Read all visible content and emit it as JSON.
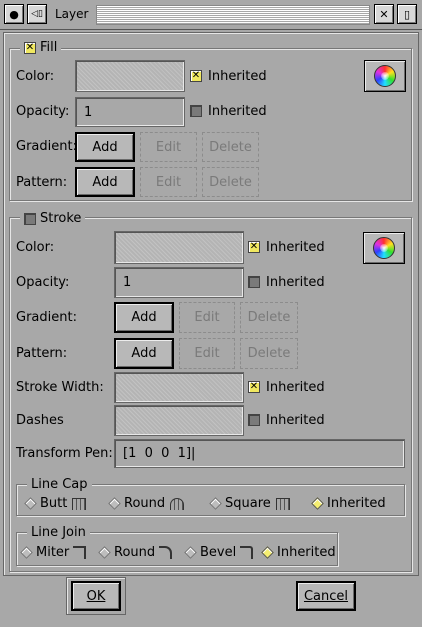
{
  "window": {
    "title": "Layer",
    "menu_glyph": "●",
    "shade_glyph": "◁▯",
    "close_glyph": "✕",
    "max_glyph": "▯"
  },
  "fill": {
    "legend": "Fill",
    "enabled": true,
    "color": {
      "label": "Color:",
      "inherited_label": "Inherited",
      "inherited": true
    },
    "opacity": {
      "label": "Opacity:",
      "value": "1",
      "inherited_label": "Inherited",
      "inherited": false
    },
    "gradient": {
      "label": "Gradient:",
      "add": "Add",
      "edit": "Edit",
      "delete": "Delete"
    },
    "pattern": {
      "label": "Pattern:",
      "add": "Add",
      "edit": "Edit",
      "delete": "Delete"
    }
  },
  "stroke": {
    "legend": "Stroke",
    "enabled": false,
    "color": {
      "label": "Color:",
      "inherited_label": "Inherited",
      "inherited": true
    },
    "opacity": {
      "label": "Opacity:",
      "value": "1",
      "inherited_label": "Inherited",
      "inherited": false
    },
    "gradient": {
      "label": "Gradient:",
      "add": "Add",
      "edit": "Edit",
      "delete": "Delete"
    },
    "pattern": {
      "label": "Pattern:",
      "add": "Add",
      "edit": "Edit",
      "delete": "Delete"
    },
    "width": {
      "label": "Stroke Width:",
      "inherited_label": "Inherited",
      "inherited": true
    },
    "dashes": {
      "label": "Dashes",
      "inherited_label": "Inherited",
      "inherited": false
    },
    "transform": {
      "label": "Transform Pen:",
      "value": "[1  0  0  1]|"
    }
  },
  "line_cap": {
    "legend": "Line Cap",
    "options": [
      "Butt",
      "Round",
      "Square",
      "Inherited"
    ],
    "selected": "Inherited"
  },
  "line_join": {
    "legend": "Line Join",
    "options": [
      "Miter",
      "Round",
      "Bevel",
      "Inherited"
    ],
    "selected": "Inherited"
  },
  "footer": {
    "ok": "OK",
    "cancel": "Cancel"
  },
  "colors": {
    "background": "#a8a8a8",
    "checked": "#f0e860"
  }
}
